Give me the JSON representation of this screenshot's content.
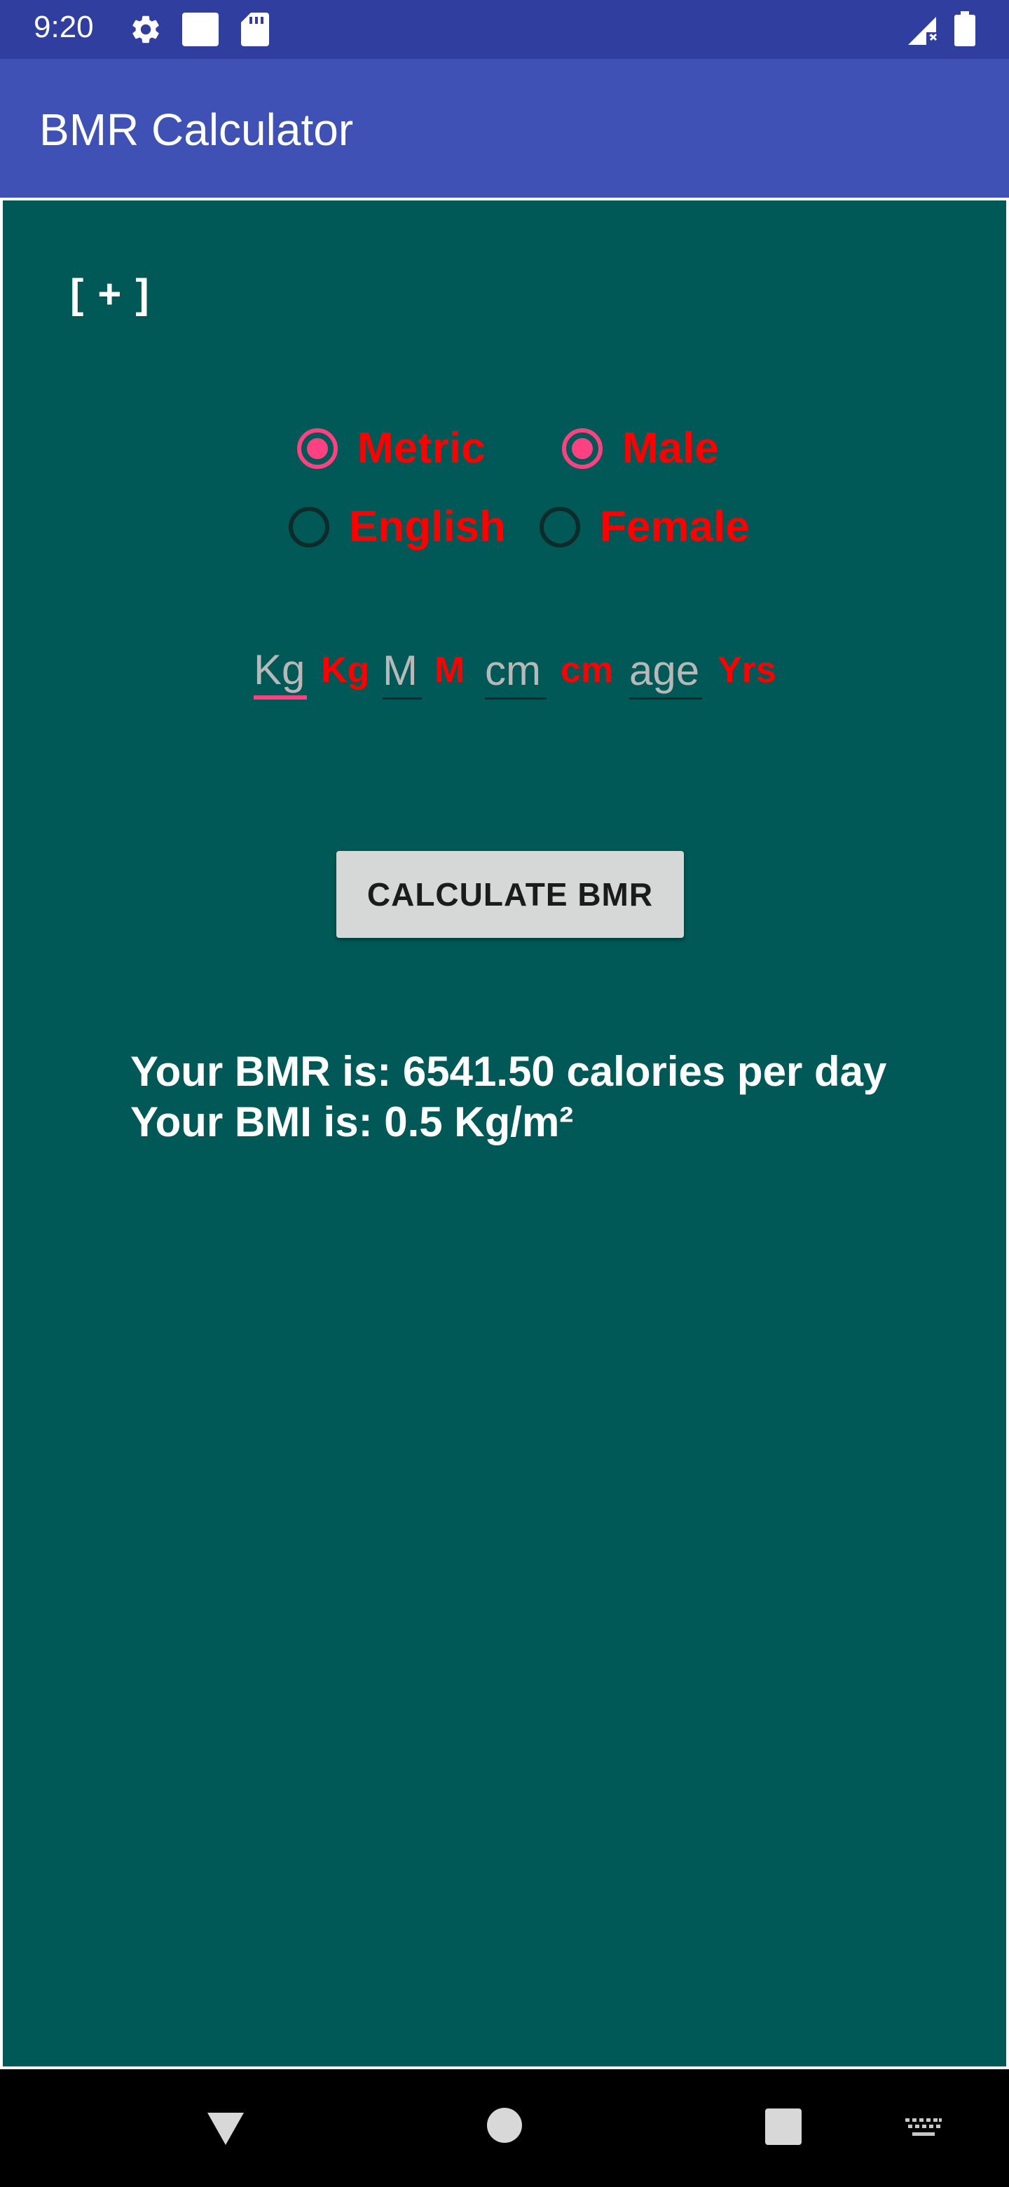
{
  "status_bar": {
    "time": "9:20",
    "icons": [
      "gear-icon",
      "square-notification-icon",
      "sd-card-icon",
      "signal-icon",
      "battery-icon"
    ]
  },
  "app_bar": {
    "title": "BMR Calculator",
    "color": "#3F51B5"
  },
  "content": {
    "background": "#005956",
    "expand_toggle": "[ + ]",
    "radios": {
      "units": [
        {
          "label": "Metric",
          "checked": true
        },
        {
          "label": "English",
          "checked": false
        }
      ],
      "gender": [
        {
          "label": "Male",
          "checked": true
        },
        {
          "label": "Female",
          "checked": false
        }
      ]
    },
    "inputs": {
      "weight": {
        "placeholder": "Kg",
        "value": "",
        "unit": "Kg",
        "focused": true
      },
      "meters": {
        "placeholder": "M",
        "value": "",
        "unit": "M"
      },
      "centimeters": {
        "placeholder": "cm",
        "value": "",
        "unit": "cm"
      },
      "age": {
        "placeholder": "age",
        "value": "",
        "unit": "Yrs"
      }
    },
    "calculate_button": "CALCULATE BMR",
    "results": {
      "bmr_line": "Your BMR is: 6541.50 calories per day",
      "bmi_line": "Your BMI is: 0.5 Kg/m²"
    },
    "accent_color": "#FF4081",
    "label_color": "#FF0000"
  },
  "nav_bar": {
    "buttons": [
      "back-icon",
      "home-icon",
      "recents-icon",
      "keyboard-icon"
    ]
  }
}
